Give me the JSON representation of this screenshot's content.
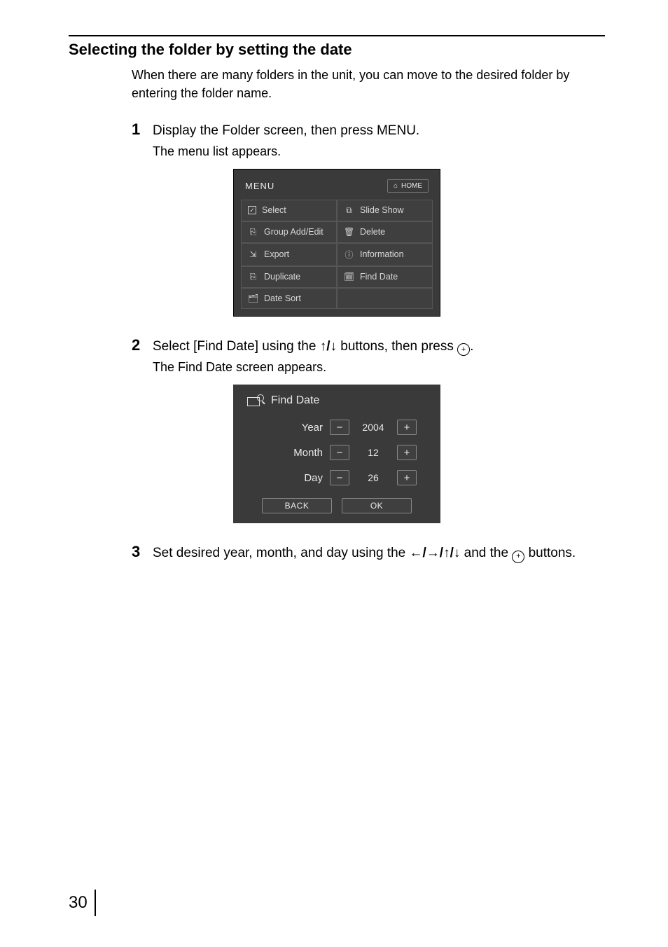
{
  "section_title": "Selecting the folder by setting the date",
  "intro": "When there are many folders in the unit, you can move to the desired folder by entering the folder name.",
  "steps": {
    "s1": {
      "num": "1",
      "text": "Display the Folder screen, then press MENU.",
      "sub": "The menu list appears."
    },
    "s2": {
      "num": "2",
      "text_a": "Select [Find Date] using the ",
      "arrows": "↑/↓",
      "text_b": " buttons, then press ",
      "enter": "+",
      "text_c": ".",
      "sub": "The Find Date screen appears."
    },
    "s3": {
      "num": "3",
      "text_a": "Set desired year, month, and day using the ",
      "arrows": "←/→/↑/↓",
      "text_b": " and the ",
      "enter": "+",
      "text_c": " buttons."
    }
  },
  "menu": {
    "title": "MENU",
    "home": "HOME",
    "items": {
      "select": "Select",
      "slideshow": "Slide Show",
      "group": "Group Add/Edit",
      "delete": "Delete",
      "export": "Export",
      "info": "Information",
      "duplicate": "Duplicate",
      "finddate": "Find Date",
      "datesort": "Date Sort"
    }
  },
  "find": {
    "title": "Find Date",
    "rows": {
      "year": {
        "label": "Year",
        "minus": "−",
        "value": "2004",
        "plus": "+"
      },
      "month": {
        "label": "Month",
        "minus": "−",
        "value": "12",
        "plus": "+"
      },
      "day": {
        "label": "Day",
        "minus": "−",
        "value": "26",
        "plus": "+"
      }
    },
    "back": "BACK",
    "ok": "OK"
  },
  "page_number": "30"
}
